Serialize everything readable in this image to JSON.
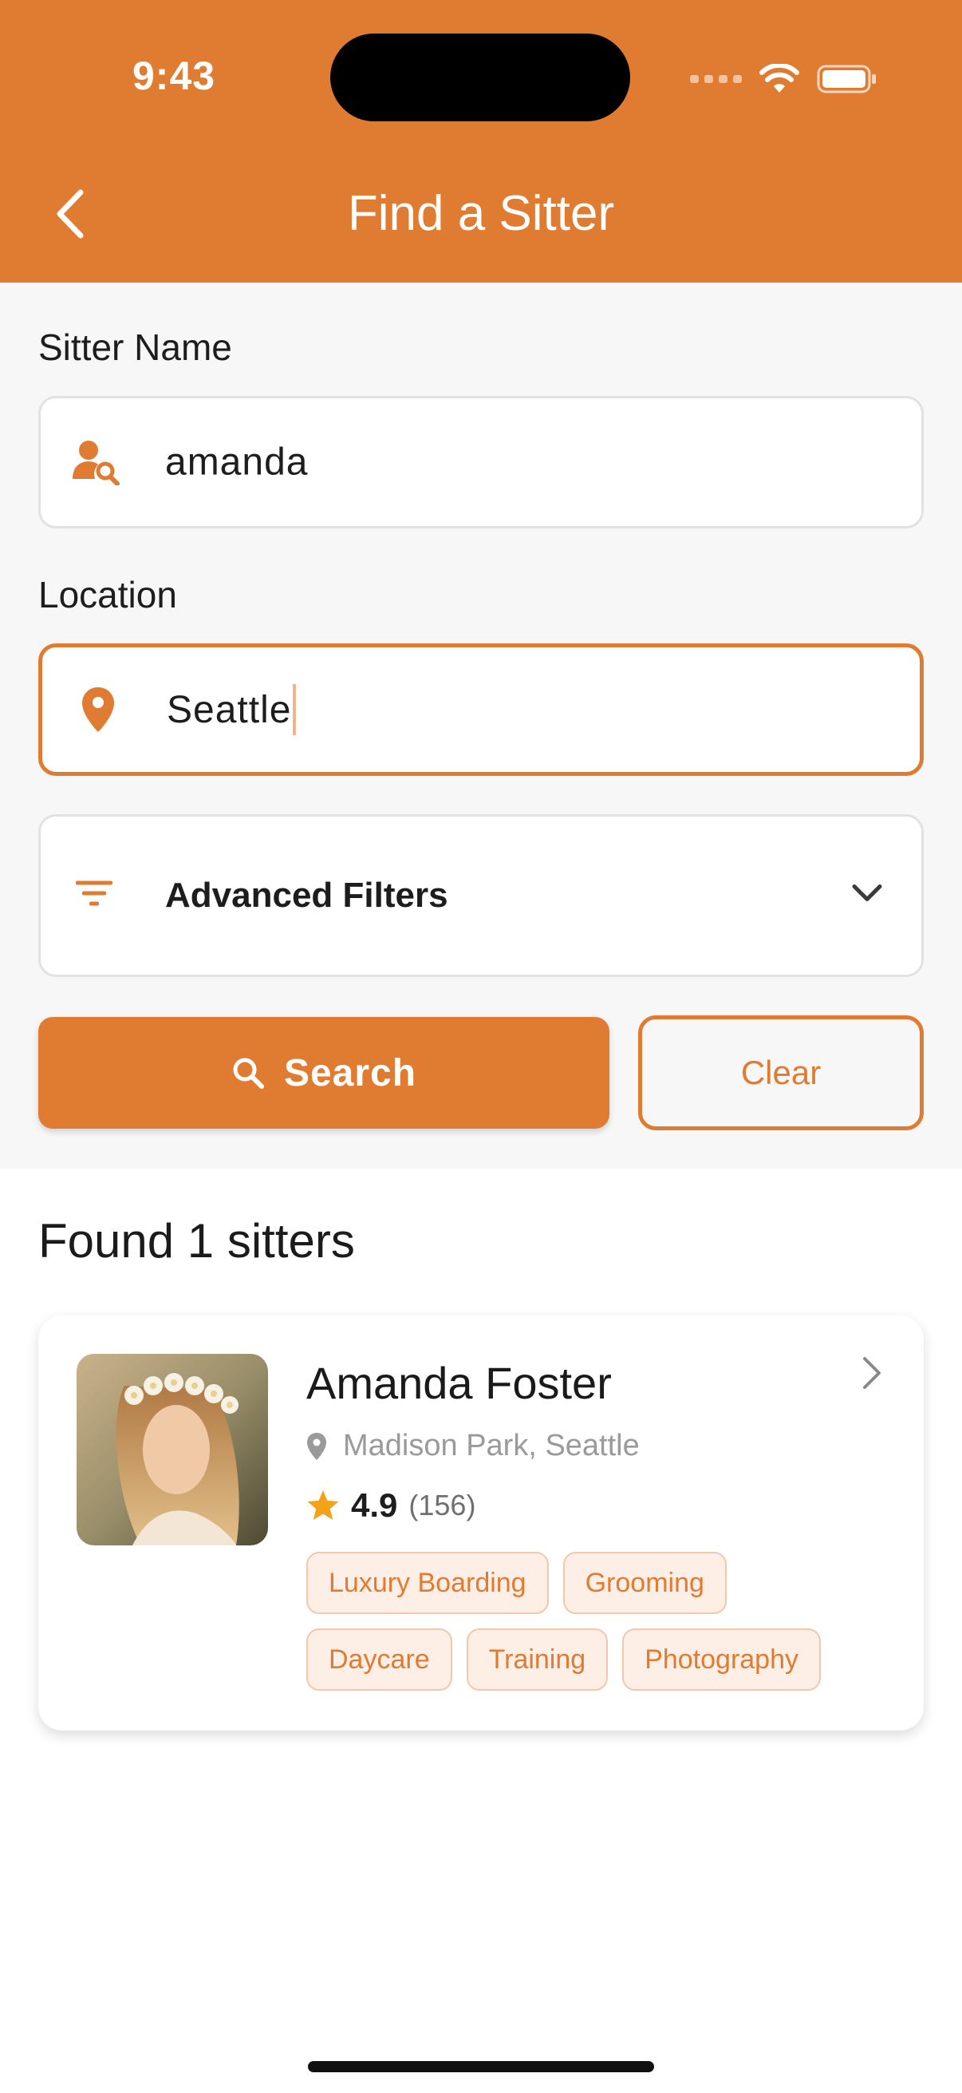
{
  "status_bar": {
    "time": "9:43"
  },
  "header": {
    "title": "Find a Sitter",
    "accent": "#E07B32"
  },
  "form": {
    "name_label": "Sitter Name",
    "name_value": "amanda",
    "name_icon": "person-search-icon",
    "location_label": "Location",
    "location_value": "Seattle",
    "location_icon": "location-pin-icon",
    "filters_label": "Advanced Filters",
    "search_label": "Search",
    "clear_label": "Clear"
  },
  "results": {
    "title": "Found 1 sitters",
    "sitters": [
      {
        "name": "Amanda Foster",
        "location": "Madison Park, Seattle",
        "rating": "4.9",
        "reviews": "(156)",
        "tags_row1": [
          "Luxury Boarding",
          "Grooming"
        ],
        "tags_row2": [
          "Daycare",
          "Training",
          "Photography"
        ]
      }
    ]
  }
}
